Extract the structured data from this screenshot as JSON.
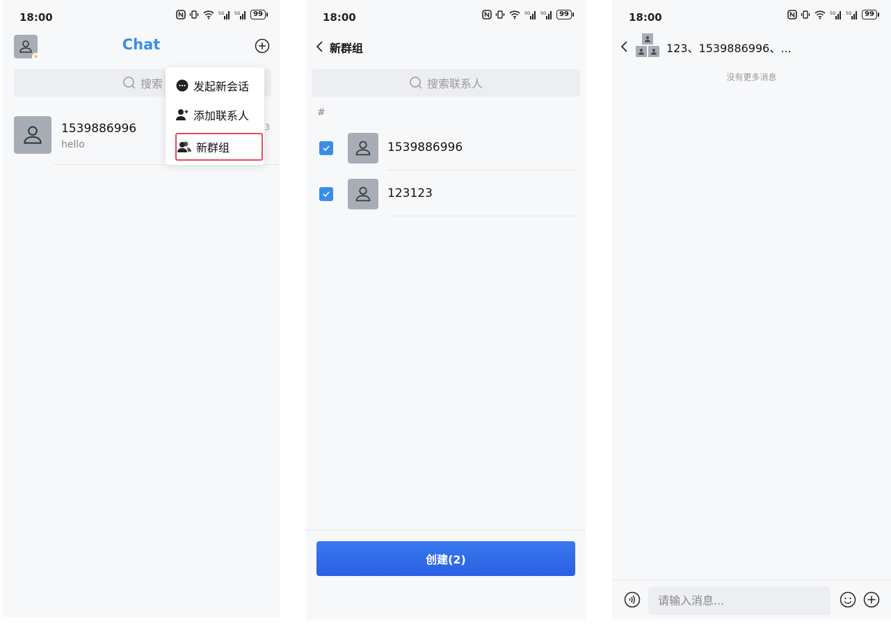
{
  "status_bar": {
    "time": "18:00",
    "signal_label": "5G",
    "battery": "99"
  },
  "chat_list": {
    "title": "Chat",
    "search_placeholder": "搜索",
    "conversations": [
      {
        "name": "1539886996",
        "last_message": "hello",
        "time": "3"
      }
    ],
    "menu": {
      "items": [
        {
          "label": "发起新会话",
          "icon": "chat-bubble-icon"
        },
        {
          "label": "添加联系人",
          "icon": "add-user-icon"
        },
        {
          "label": "新群组",
          "icon": "group-icon"
        }
      ]
    }
  },
  "new_group": {
    "title": "新群组",
    "search_placeholder": "搜索联系人",
    "section": "#",
    "contacts": [
      {
        "name": "1539886996",
        "checked": true
      },
      {
        "name": "123123",
        "checked": true
      }
    ],
    "create_label": "创建(2)"
  },
  "group_chat": {
    "title": "123、1539886996、...",
    "no_more": "没有更多消息",
    "input_placeholder": "请输入消息..."
  },
  "colors": {
    "accent": "#3a8ee6",
    "button": "#2f66e8",
    "highlight": "#e24a5a",
    "avatar": "#a7adb5"
  }
}
